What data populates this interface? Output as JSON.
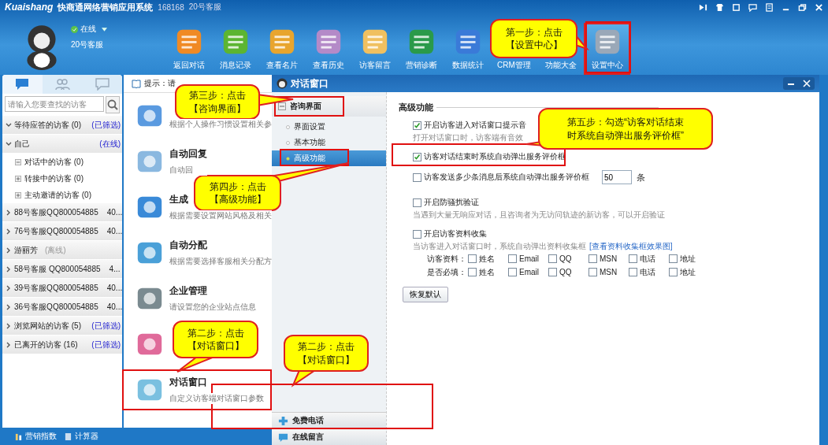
{
  "app": {
    "logo": "Kuaishang",
    "title": "快商通网络营销应用系统",
    "account": "168168",
    "agent": "20号客服"
  },
  "user": {
    "status": "在线",
    "name": "20号客服"
  },
  "toolbar": [
    {
      "label": "返回对话",
      "selected": false
    },
    {
      "label": "消息记录",
      "selected": false
    },
    {
      "label": "查看名片",
      "selected": false
    },
    {
      "label": "查看历史",
      "selected": false
    },
    {
      "label": "访客留言",
      "selected": false
    },
    {
      "label": "营销诊断",
      "selected": false
    },
    {
      "label": "数据统计",
      "selected": false
    },
    {
      "label": "CRM管理",
      "selected": false
    },
    {
      "label": "功能大全",
      "selected": false
    },
    {
      "label": "设置中心",
      "selected": true
    }
  ],
  "sidebar": {
    "tabs": [
      {
        "selected": true
      },
      {
        "selected": false
      },
      {
        "selected": false
      }
    ],
    "search": {
      "placeholder": "请输入您要查找的访客"
    },
    "groups": [
      {
        "label": "等待应答的访客 (0)",
        "expanded": true,
        "tag": {
          "text": "(已筛选)",
          "muted": false
        }
      },
      {
        "label": "自己",
        "expanded": true,
        "tag": {
          "text": "(在线)",
          "muted": false
        },
        "children": [
          {
            "label": "对话中的访客 (0)",
            "expanded": true
          },
          {
            "label": "转接中的访客 (0)",
            "expanded": false
          },
          {
            "label": "主动邀请的访客 (0)",
            "expanded": false
          }
        ]
      },
      {
        "label": "88号客服QQ800054885",
        "expanded": false,
        "extra": "40..."
      },
      {
        "label": "76号客服QQ800054885",
        "expanded": false,
        "extra": "40..."
      },
      {
        "label": "游丽芳",
        "expanded": false,
        "tag": {
          "text": "(离线)",
          "muted": true
        }
      },
      {
        "label": "58号客服 QQ800054885",
        "expanded": false,
        "extra": "4..."
      },
      {
        "label": "39号客服QQ800054885",
        "expanded": false,
        "extra": "40..."
      },
      {
        "label": "36号客服QQ800054885",
        "expanded": false,
        "extra": "40..."
      },
      {
        "label": "浏览网站的访客 (5)",
        "expanded": false,
        "tag": {
          "text": "(已筛选)",
          "muted": false
        }
      },
      {
        "label": "已离开的访客 (16)",
        "expanded": false,
        "tag": {
          "text": "(已筛选)",
          "muted": false
        }
      }
    ],
    "footer": [
      "营销指数",
      "计算器"
    ]
  },
  "settings": {
    "hint": "提示：请",
    "items": [
      {
        "kind": "entry",
        "desc": "根据个人操作习惯设置相关参"
      },
      {
        "kind": "entry",
        "title": "自动回复",
        "desc": "自动回"
      },
      {
        "kind": "entry",
        "title": "生成",
        "desc": "根据需要设置网站风格及相关"
      },
      {
        "kind": "entry",
        "title": "自动分配",
        "desc": "根据需要选择客服相关分配方"
      },
      {
        "kind": "entry",
        "title": "企业管理",
        "desc": "请设置您的企业站点信息"
      },
      {
        "kind": "icon"
      },
      {
        "kind": "entry",
        "title": "对话窗口",
        "desc": "自定义访客端对话窗口参数"
      }
    ]
  },
  "dialog": {
    "title": "对话窗口",
    "nav": {
      "group": "咨询界面",
      "items": [
        {
          "label": "界面设置",
          "selected": false
        },
        {
          "label": "基本功能",
          "selected": false
        },
        {
          "label": "高级功能",
          "selected": true
        }
      ],
      "bottom": [
        "免费电话",
        "在线留言"
      ]
    },
    "section": "高级功能",
    "options": [
      {
        "kind": "checkbox",
        "label": "开启访客进入对话窗口提示音",
        "checked": true,
        "hint": "打开对话窗口时，访客端有音效"
      },
      {
        "kind": "checkbox",
        "label": "访客对话结束时系统自动弹出服务评价框",
        "checked": true
      },
      {
        "kind": "count",
        "label": "访客发送多少条消息后系统自动弹出服务评价框",
        "checked": false,
        "value": "50",
        "unit": "条"
      },
      {
        "kind": "checkbox",
        "label": "开启防骚扰验证",
        "checked": false,
        "hint": "当遇到大量无响应对话，且咨询者为无访问轨迹的新访客，可以开启验证"
      },
      {
        "kind": "collect",
        "label": "开启访客资料收集",
        "checked": false,
        "hint": "当访客进入对话窗口时，系统自动弹出资料收集框",
        "link": "[查看资料收集框效果图]",
        "rows": [
          {
            "label": "访客资料：",
            "fields": [
              {
                "label": "姓名",
                "checked": false
              },
              {
                "label": "Email",
                "checked": false
              },
              {
                "label": "QQ",
                "checked": false
              },
              {
                "label": "MSN",
                "checked": false
              },
              {
                "label": "电话",
                "checked": false
              },
              {
                "label": "地址",
                "checked": false
              }
            ]
          },
          {
            "label": "是否必填：",
            "fields": [
              {
                "label": "姓名",
                "checked": false
              },
              {
                "label": "Email",
                "checked": false
              },
              {
                "label": "QQ",
                "checked": false
              },
              {
                "label": "MSN",
                "checked": false
              },
              {
                "label": "电话",
                "checked": false
              },
              {
                "label": "地址",
                "checked": false
              }
            ]
          }
        ]
      }
    ],
    "reset": "恢复默认"
  },
  "annotations": [
    {
      "lines": [
        "第一步：点击",
        "【设置中心】"
      ]
    },
    {
      "lines": [
        "第三步：点击",
        "【咨询界面】"
      ]
    },
    {
      "lines": [
        "第四步：点击",
        "【高级功能】"
      ]
    },
    {
      "lines": [
        "第五步：勾选“访客对话结束",
        "时系统自动弹出服务评价框”"
      ]
    },
    {
      "lines": [
        "第二步：点击",
        "【对话窗口】"
      ]
    },
    {
      "lines": [
        "第二步：点击",
        "【对话窗口】"
      ]
    }
  ]
}
